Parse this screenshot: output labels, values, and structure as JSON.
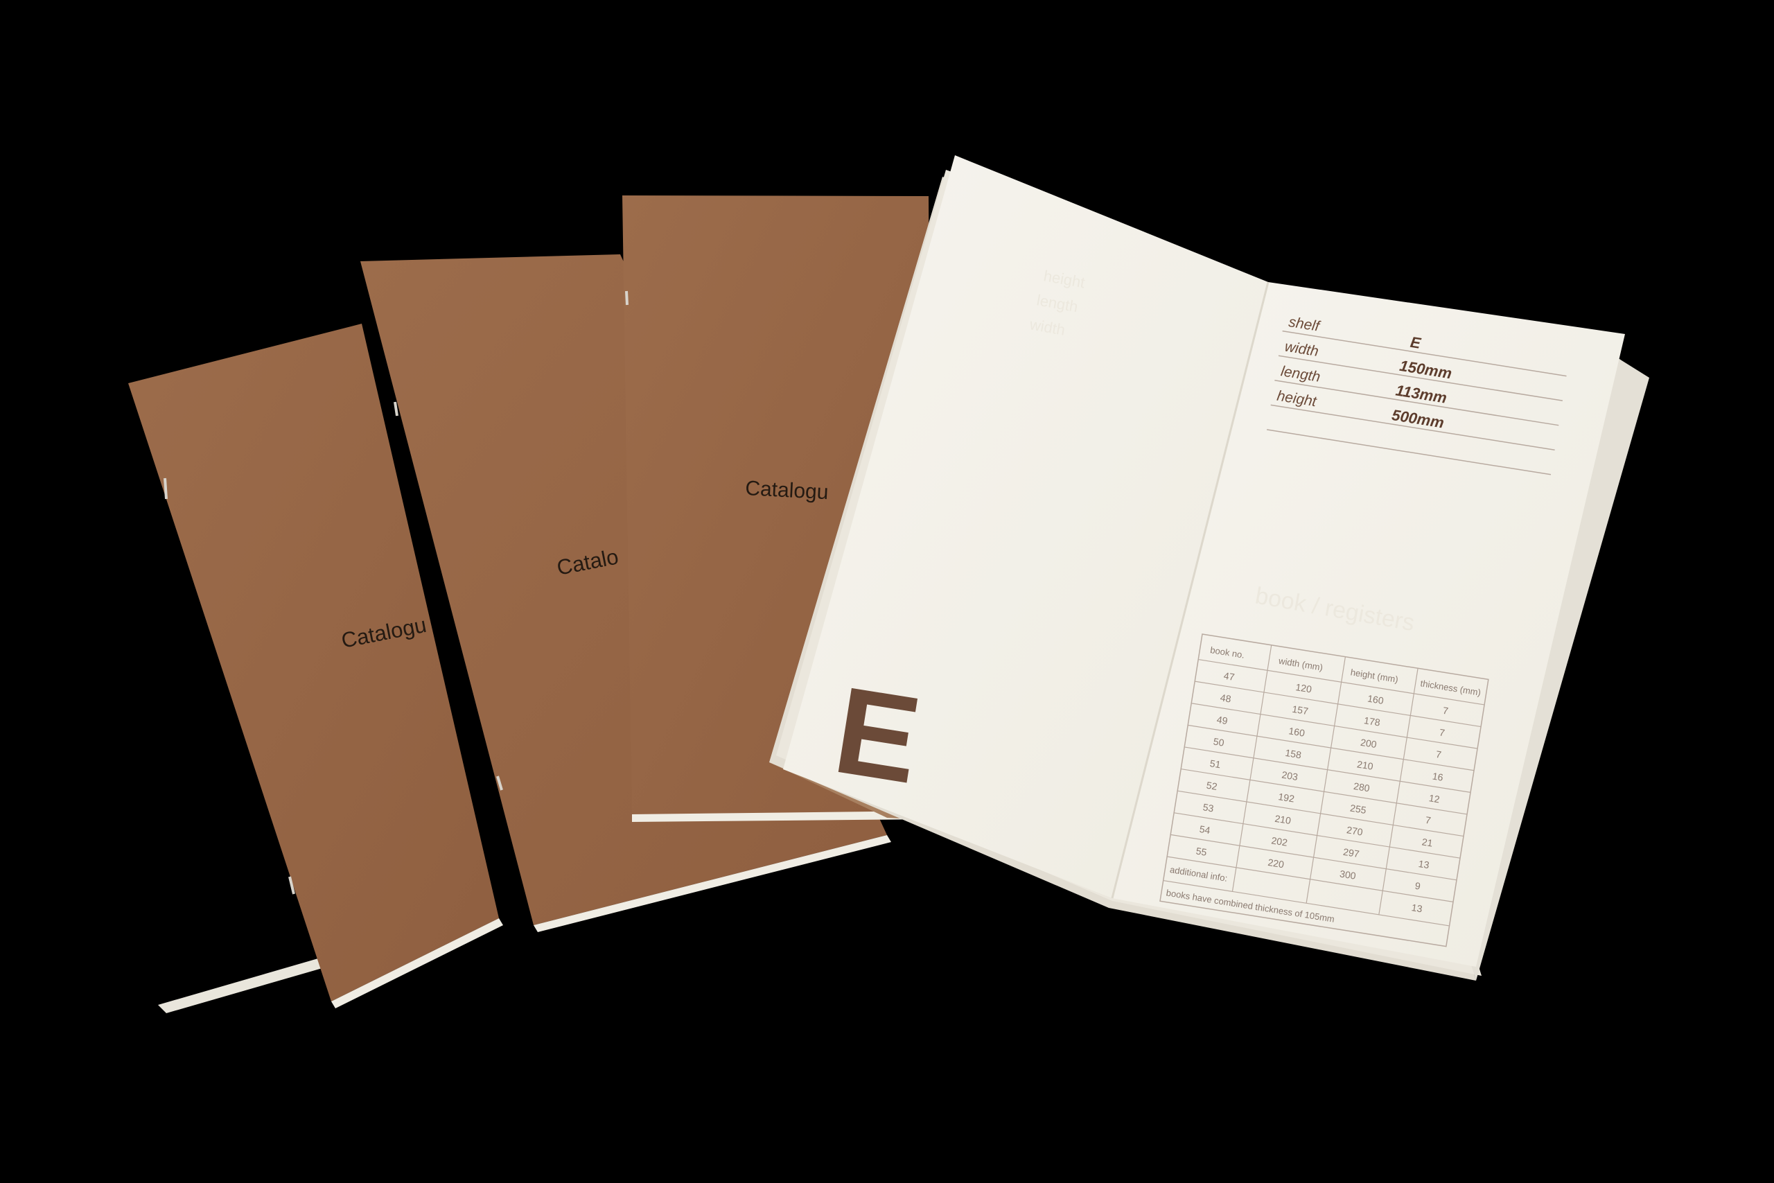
{
  "colors": {
    "background": "#000000",
    "kraft_cover": "#9a6a4a",
    "paper": "#f4f2ea",
    "print_brown": "#6b4a38"
  },
  "booklets": [
    {
      "cover_text": "Catalogu"
    },
    {
      "cover_text": "Catalo"
    },
    {
      "cover_text": "Catalogu"
    }
  ],
  "open_booklet": {
    "big_letter": "E",
    "spec_table": [
      {
        "label": "shelf",
        "value": "E"
      },
      {
        "label": "width",
        "value": "150mm"
      },
      {
        "label": "length",
        "value": "113mm"
      },
      {
        "label": "height",
        "value": "500mm"
      }
    ],
    "book_table": {
      "headers": [
        "book no.",
        "width (mm)",
        "height (mm)",
        "thickness (mm)"
      ],
      "rows": [
        [
          "47",
          "120",
          "160",
          "7"
        ],
        [
          "48",
          "157",
          "178",
          "7"
        ],
        [
          "49",
          "160",
          "200",
          "7"
        ],
        [
          "50",
          "158",
          "210",
          "16"
        ],
        [
          "51",
          "203",
          "280",
          "12"
        ],
        [
          "52",
          "192",
          "255",
          "7"
        ],
        [
          "53",
          "210",
          "270",
          "21"
        ],
        [
          "54",
          "202",
          "297",
          "13"
        ],
        [
          "55",
          "220",
          "300",
          "9"
        ],
        [
          "",
          "",
          "",
          "13"
        ]
      ],
      "footer_label": "additional info:",
      "footer_text": "books have combined thickness of 105mm"
    }
  }
}
